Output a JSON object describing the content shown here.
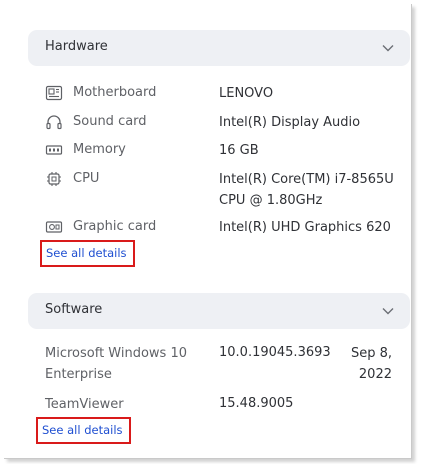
{
  "hardware": {
    "title": "Hardware",
    "items": [
      {
        "label": "Motherboard",
        "value": "LENOVO",
        "icon": "motherboard-icon"
      },
      {
        "label": "Sound card",
        "value": "Intel(R) Display Audio",
        "icon": "headphones-icon"
      },
      {
        "label": "Memory",
        "value": "16 GB",
        "icon": "memory-icon"
      },
      {
        "label": "CPU",
        "value": "Intel(R) Core(TM) i7-8565U CPU @ 1.80GHz",
        "icon": "cpu-icon"
      },
      {
        "label": "Graphic card",
        "value": "Intel(R) UHD Graphics 620",
        "icon": "graphic-card-icon"
      }
    ],
    "see_all": "See all details"
  },
  "software": {
    "title": "Software",
    "items": [
      {
        "label": "Microsoft Windows 10 Enterprise",
        "version": "10.0.19045.3693",
        "date": "Sep 8, 2022"
      },
      {
        "label": "TeamViewer",
        "version": "15.48.9005",
        "date": ""
      }
    ],
    "see_all": "See all details"
  },
  "colors": {
    "link": "#1f4fd1",
    "highlight": "#d91a1a",
    "header_bg": "#eef0f4"
  }
}
